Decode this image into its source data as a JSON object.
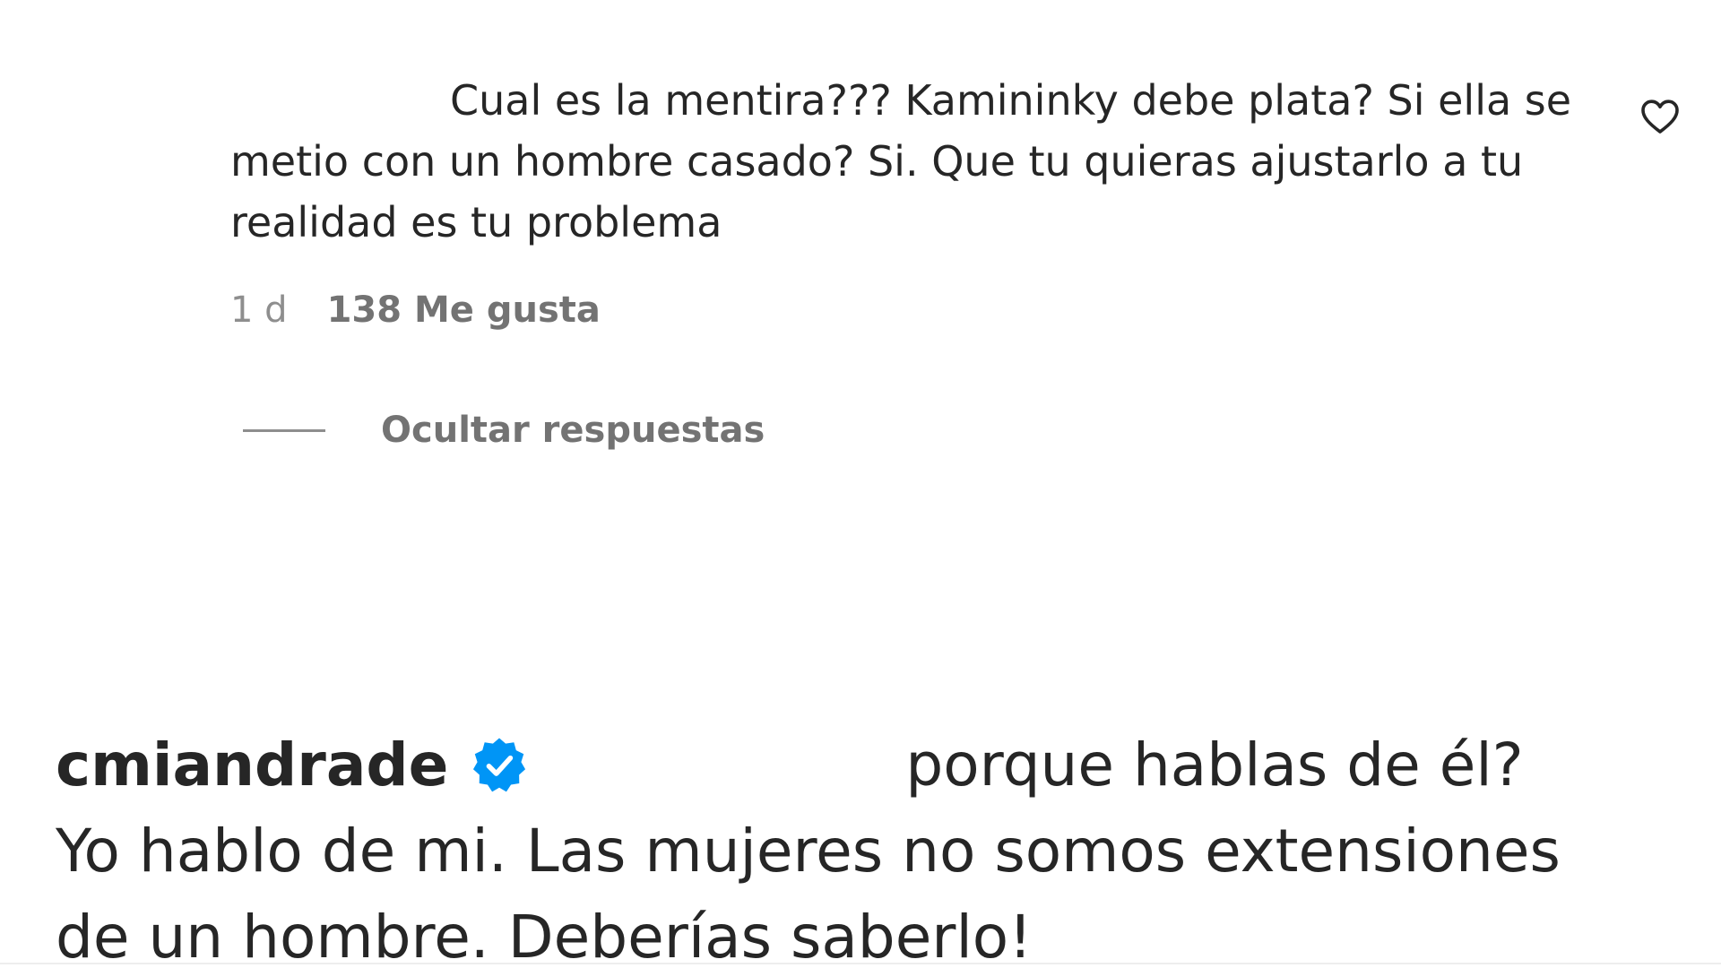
{
  "comment": {
    "text": "Cual es la mentira??? Kamininky debe plata? Si ella se metio con un hombre casado? Si. Que tu quieras ajustarlo a tu realidad es tu problema",
    "time": "1 d",
    "likes": "138 Me gusta",
    "like_icon": "heart-outline-icon"
  },
  "replies_toggle": {
    "label": "Ocultar respuestas"
  },
  "reply": {
    "username": "cmiandrade",
    "verified_icon": "verified-badge-icon",
    "first_line": "porque hablas de él?",
    "rest": "Yo hablo de mi. Las mujeres no somos extensiones de un hombre. Deberías saberlo!"
  },
  "colors": {
    "text": "#262626",
    "secondary": "#8e8e8e",
    "verified": "#0095f6"
  }
}
